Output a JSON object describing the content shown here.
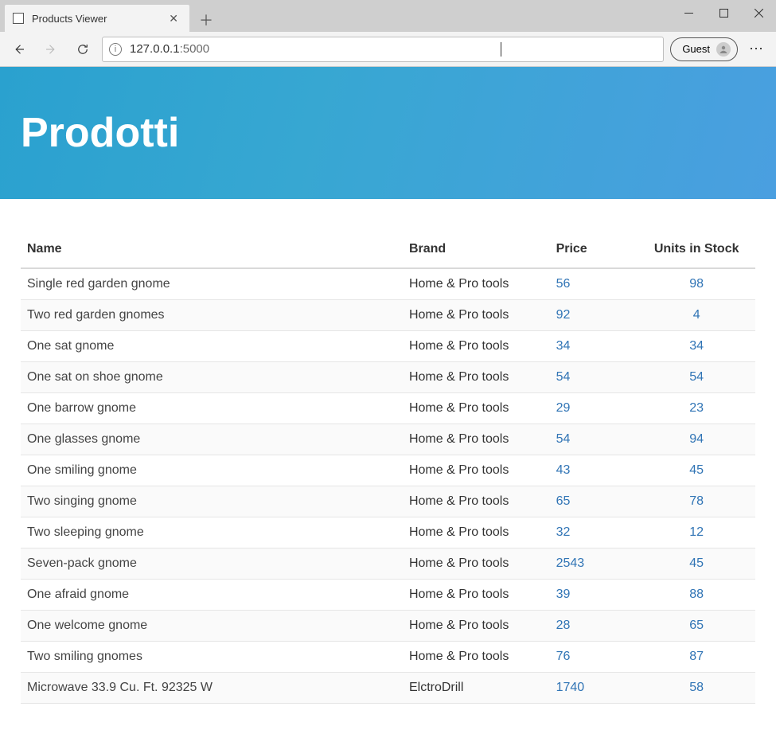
{
  "browser": {
    "tab_title": "Products Viewer",
    "url_host": "127.0.0.1",
    "url_port": ":5000",
    "guest_label": "Guest"
  },
  "page": {
    "heading": "Prodotti",
    "table": {
      "headers": {
        "name": "Name",
        "brand": "Brand",
        "price": "Price",
        "stock": "Units in Stock"
      },
      "rows": [
        {
          "name": "Single red garden gnome",
          "brand": "Home & Pro tools",
          "price": "56",
          "stock": "98"
        },
        {
          "name": "Two red garden gnomes",
          "brand": "Home & Pro tools",
          "price": "92",
          "stock": "4"
        },
        {
          "name": "One sat gnome",
          "brand": "Home & Pro tools",
          "price": "34",
          "stock": "34"
        },
        {
          "name": "One sat on shoe gnome",
          "brand": "Home & Pro tools",
          "price": "54",
          "stock": "54"
        },
        {
          "name": "One barrow gnome",
          "brand": "Home & Pro tools",
          "price": "29",
          "stock": "23"
        },
        {
          "name": "One glasses gnome",
          "brand": "Home & Pro tools",
          "price": "54",
          "stock": "94"
        },
        {
          "name": "One smiling gnome",
          "brand": "Home & Pro tools",
          "price": "43",
          "stock": "45"
        },
        {
          "name": "Two singing gnome",
          "brand": "Home & Pro tools",
          "price": "65",
          "stock": "78"
        },
        {
          "name": "Two sleeping gnome",
          "brand": "Home & Pro tools",
          "price": "32",
          "stock": "12"
        },
        {
          "name": "Seven-pack gnome",
          "brand": "Home & Pro tools",
          "price": "2543",
          "stock": "45"
        },
        {
          "name": "One afraid gnome",
          "brand": "Home & Pro tools",
          "price": "39",
          "stock": "88"
        },
        {
          "name": "One welcome gnome",
          "brand": "Home & Pro tools",
          "price": "28",
          "stock": "65"
        },
        {
          "name": "Two smiling gnomes",
          "brand": "Home & Pro tools",
          "price": "76",
          "stock": "87"
        },
        {
          "name": "Microwave 33.9 Cu. Ft. 92325 W",
          "brand": "ElctroDrill",
          "price": "1740",
          "stock": "58"
        }
      ]
    }
  }
}
